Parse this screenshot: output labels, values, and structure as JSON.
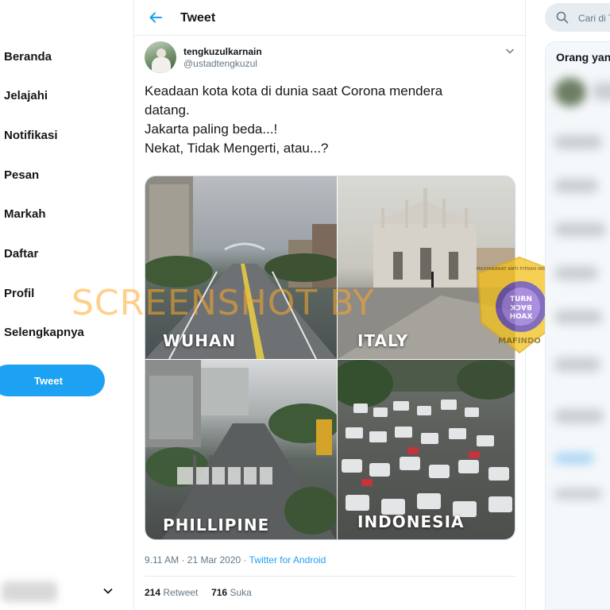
{
  "nav": {
    "items": [
      "Beranda",
      "Jelajahi",
      "Notifikasi",
      "Pesan",
      "Markah",
      "Daftar",
      "Profil",
      "Selengkapnya"
    ],
    "tweet_button": "Tweet"
  },
  "header": {
    "title": "Tweet"
  },
  "tweet": {
    "name": "tengkuzulkarnain",
    "handle": "@ustadtengkuzul",
    "lines": [
      "Keadaan kota kota di dunia saat Corona mendera",
      "datang.",
      "Jakarta paling beda...!",
      "Nekat, Tidak Mengerti, atau...?"
    ],
    "image_labels": {
      "top_left": "WUHAN",
      "top_right": "ITALY",
      "bottom_left": "PHILLIPINE",
      "bottom_right": "INDONESIA"
    },
    "timestamp": "9.11 AM · 21 Mar 2020 · ",
    "source": "Twitter for Android",
    "retweets": "214",
    "retweets_label": " Retweet",
    "likes": "716",
    "likes_label": " Suka"
  },
  "overlay": {
    "watermark": "SCREENSHOT BY",
    "badge_top": "MASYARAKAT ANTI FITNAH INDONESIA",
    "badge_bottom": "MAFINDO",
    "badge_center": [
      "TURN",
      "BACK",
      "HOAX"
    ]
  },
  "right": {
    "search_placeholder": "Cari di Twitter",
    "who_to_follow_title": "Orang yang mungkin Anda kenal"
  },
  "colors": {
    "accent": "#1da1f2",
    "text_secondary": "#657786",
    "border": "#e6ecf0"
  }
}
